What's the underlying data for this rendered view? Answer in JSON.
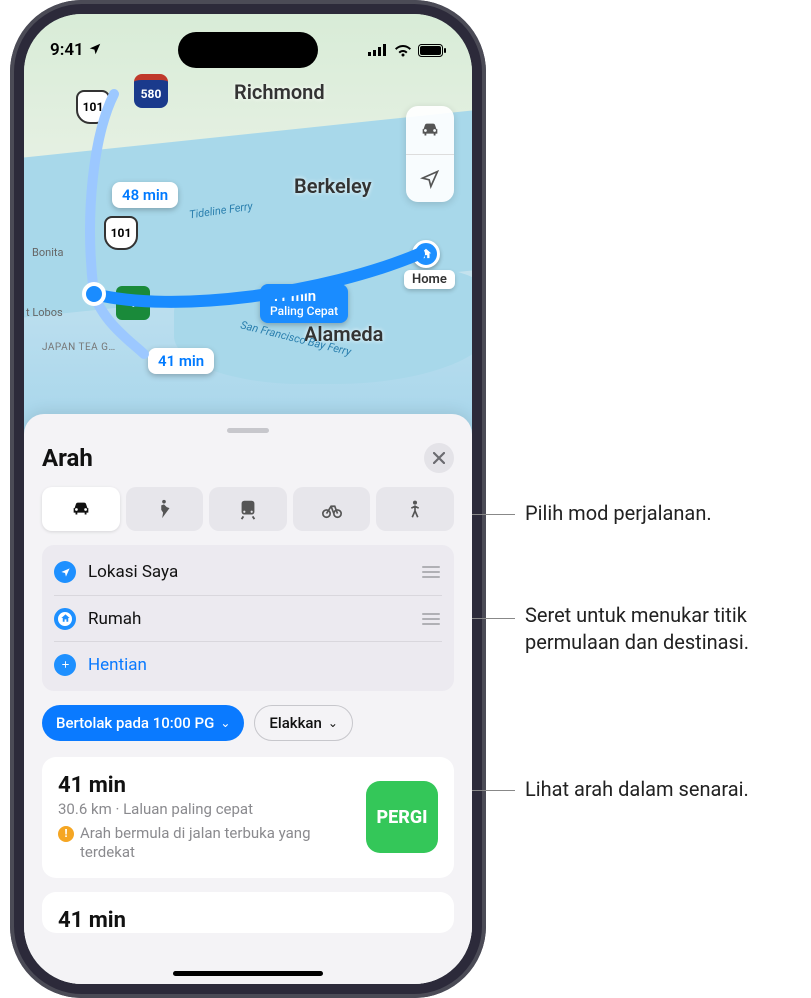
{
  "status_bar": {
    "time": "9:41",
    "has_location_arrow": true
  },
  "map": {
    "cities": {
      "richmond": "Richmond",
      "berkeley": "Berkeley",
      "alameda": "Alameda"
    },
    "ferry_labels": {
      "tideline": "Tideline Ferry",
      "sfbay": "San Francisco Bay Ferry"
    },
    "area_labels": {
      "japan_tea": "JAPAN TEA G…",
      "bonita": "Bonita",
      "lobos": "t Lobos"
    },
    "shields": {
      "us101": "101",
      "i580": "580",
      "ca1": "1"
    },
    "home_pin_label": "Home",
    "route_bubbles": {
      "alt1": "48 min",
      "alt2": "41 min",
      "primary_time": "41 min",
      "primary_sub": "Paling Cepat"
    }
  },
  "sheet": {
    "title": "Arah",
    "modes": [
      "drive",
      "walk",
      "transit",
      "cycle",
      "rideshare"
    ],
    "waypoints": {
      "start": "Lokasi Saya",
      "end": "Rumah",
      "add_stop": "Hentian"
    },
    "depart_chip": "Bertolak pada 10:00 PG",
    "avoid_chip": "Elakkan",
    "routes": [
      {
        "time": "41 min",
        "subtitle": "30.6 km · Laluan paling cepat",
        "warning": "Arah bermula di jalan terbuka yang terdekat",
        "go_label": "PERGI"
      },
      {
        "time": "41 min"
      }
    ]
  },
  "callouts": {
    "modes": "Pilih mod perjalanan.",
    "drag": "Seret untuk menukar titik permulaan dan destinasi.",
    "list": "Lihat arah dalam senarai."
  }
}
